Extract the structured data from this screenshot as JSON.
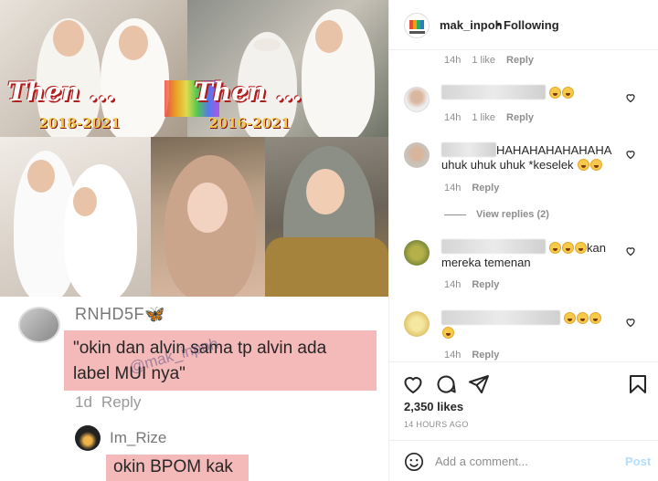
{
  "post_image": {
    "then_left": "Then ...",
    "years_left": "2018-2021",
    "then_right": "Then ...",
    "years_right": "2016-2021",
    "tiktok": {
      "username": "RNHD5F",
      "comment": "\"okin dan alvin sama tp alvin ada label MUI nya\"",
      "age": "1d",
      "reply": "Reply",
      "watermark": "@mak_inpoh",
      "reply_username": "Im_Rize",
      "reply_text": "okin BPOM kak"
    }
  },
  "header": {
    "username": "mak_inpoh",
    "separator": "•",
    "follow_status": "Following"
  },
  "comments": [
    {
      "time": "14h",
      "likes": "1 like",
      "reply": "Reply"
    },
    {
      "text": "",
      "time": "14h",
      "likes": "1 like",
      "reply": "Reply"
    },
    {
      "text_line1": "HAHAHAHAHAHAHA",
      "text_line2": "uhuk uhuk uhuk *keselek",
      "time": "14h",
      "reply": "Reply",
      "view_replies": "View replies (2)"
    },
    {
      "text_line1": "kan",
      "text_line2": "mereka temenan",
      "time": "14h",
      "reply": "Reply"
    },
    {
      "time": "14h",
      "reply": "Reply"
    }
  ],
  "actions": {
    "likes": "2,350 likes",
    "time_ago": "14 HOURS AGO"
  },
  "add_comment": {
    "placeholder": "Add a comment...",
    "post_label": "Post"
  },
  "colors": {
    "link_disabled": "#b2dffc",
    "muted": "#8e8e8e",
    "highlight": "#f4b9b9"
  }
}
